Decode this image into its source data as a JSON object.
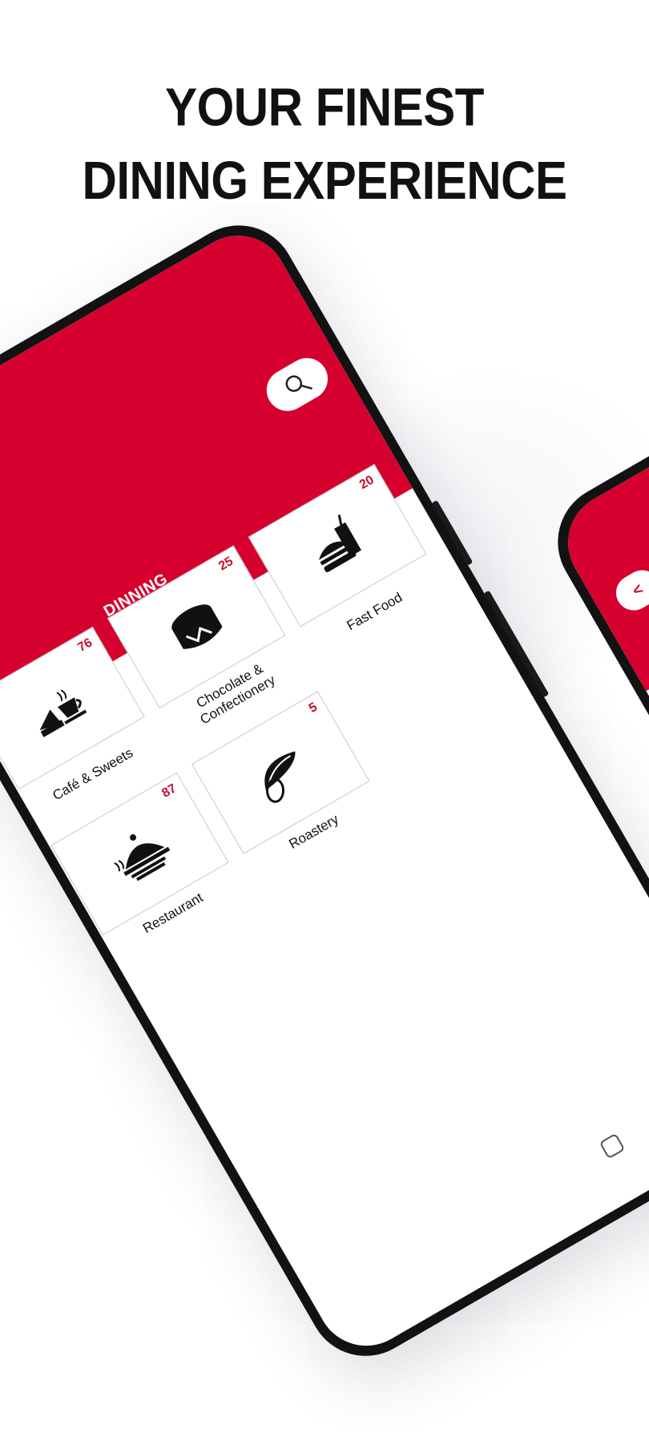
{
  "headline": {
    "line1": "YOUR FINEST",
    "line2": "DINING EXPERIENCE"
  },
  "app": {
    "title": "DINNING",
    "accent_color": "#d6002f",
    "count_color": "#c8102e",
    "search_icon": "search-icon",
    "back_icon": "chevron-left-icon"
  },
  "categories": [
    {
      "label": "Fast Food",
      "count": "20",
      "icon": "burger-drink-icon"
    },
    {
      "label": "Chocolate &\nConfectionery",
      "count": "25",
      "icon": "cake-icon"
    },
    {
      "label": "Café & Sweets",
      "count": "76",
      "icon": "coffee-cake-icon"
    },
    {
      "label": "Roastery",
      "count": "5",
      "icon": "seed-icon"
    },
    {
      "label": "Restaurant",
      "count": "87",
      "icon": "cloche-icon"
    }
  ]
}
